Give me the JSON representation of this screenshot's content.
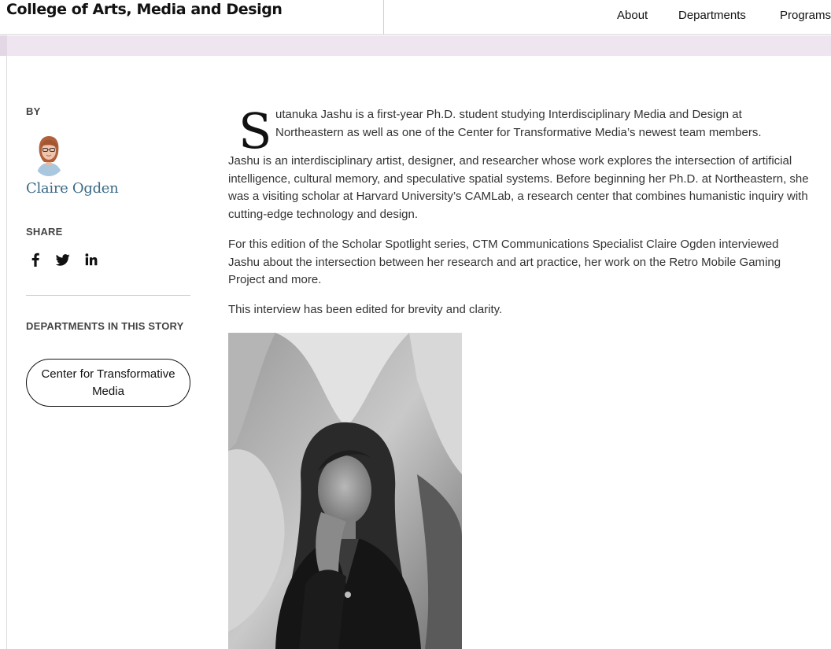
{
  "header": {
    "site_title": "College of Arts, Media and Design",
    "nav": [
      "About",
      "Departments",
      "Programs"
    ]
  },
  "colors": {
    "band": "#efe5f1",
    "author_link": "#3b6b87"
  },
  "sidebar": {
    "by_label": "BY",
    "author_name": "Claire Ogden",
    "share_label": "SHARE",
    "share_icons": [
      "facebook-icon",
      "twitter-icon",
      "linkedin-icon"
    ],
    "departments_label": "DEPARTMENTS IN THIS STORY",
    "department": "Center for Transformative Media"
  },
  "article": {
    "dropcap": "S",
    "p1": "utanuka Jashu is a first-year Ph.D. student studying Interdisciplinary Media and Design at Northeastern as well as one of the Center for Transformative Media’s newest team members.",
    "p2": "Jashu is an interdisciplinary artist, designer, and researcher whose work explores the intersection of artificial intelligence, cultural memory, and speculative spatial systems. Before beginning her Ph.D. at Northeastern, she was a visiting scholar at Harvard University’s CAMLab, a research center that combines humanistic inquiry with cutting-edge technology and design.",
    "p3": "For this edition of the Scholar Spotlight series, CTM Communications Specialist Claire Ogden interviewed Jashu about the intersection between her research and art practice, her work on the Retro Mobile Gaming Project and more.",
    "p4": "This interview has been edited for brevity and clarity."
  }
}
